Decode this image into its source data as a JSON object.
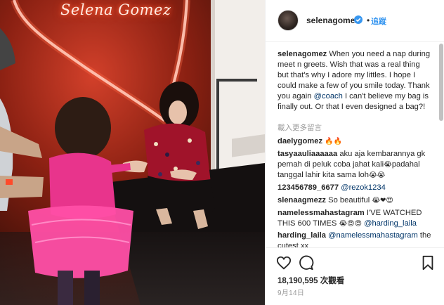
{
  "media": {
    "neon_sign_text": "Selena Gomez",
    "description_alt": "photo"
  },
  "header": {
    "username": "selenagomez",
    "separator": "•",
    "follow_label": "追蹤"
  },
  "caption": {
    "username": "selenagomez",
    "text_1": " When you need a nap during meet n greets. Wish that was a real thing but that's why I adore my littles. I hope I could make a few of you smile today. Thank you again ",
    "mention": "@coach",
    "text_2": " I can't believe my bag is finally out. Or that I even designed a bag?!"
  },
  "load_more": "載入更多留言",
  "comments": [
    {
      "username": "daelygomez",
      "text": "",
      "emoji": "🔥🔥"
    },
    {
      "username": "tasyaauliaaaaaa",
      "text": " aku aja kembarannya gk pernah di peluk coba jahat kali",
      "emoji_mid": "😭",
      "text_b": "padahal tanggal lahir kita sama loh",
      "emoji": "😭😭"
    },
    {
      "username": "123456789_6677",
      "text": " ",
      "mention": "@rezok1234"
    },
    {
      "username": "slenaagmezz",
      "text": " So beautiful",
      "emoji": "😭❤😍"
    },
    {
      "username": "namelessmahastagram",
      "text": " I'VE WATCHED THIS 600 TIMES ",
      "emoji": "😭😍😍",
      "mention": "@harding_laila"
    },
    {
      "username": "harding_laila",
      "text": " the cutest xx",
      "mention": "@namelessmahastagram"
    }
  ],
  "stats": {
    "views": "18,190,595 次觀看",
    "date": "9月14日"
  },
  "colors": {
    "link": "#003569",
    "follow": "#3897f0",
    "muted": "#999999",
    "text": "#262626"
  },
  "icons": [
    "verified-badge-icon",
    "heart-icon",
    "comment-icon",
    "bookmark-icon"
  ]
}
